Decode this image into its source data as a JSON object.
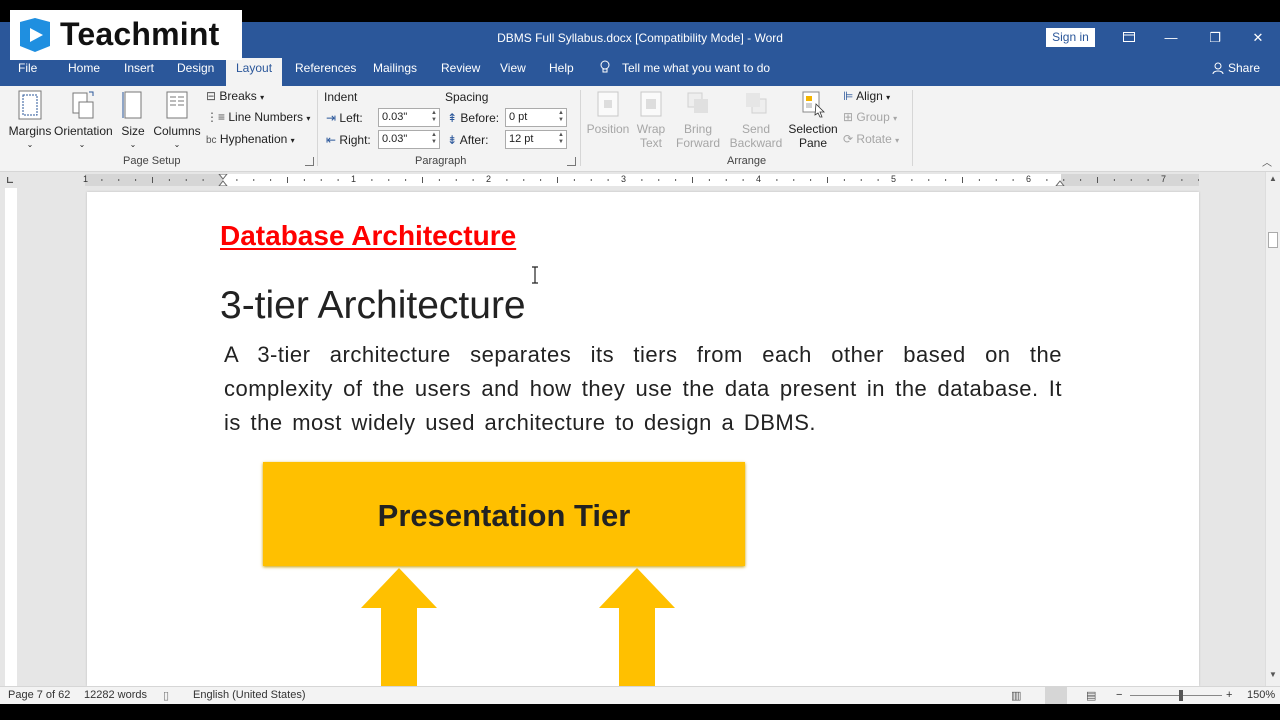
{
  "logo": {
    "text": "Teachmint"
  },
  "window": {
    "title": "DBMS Full Syllabus.docx [Compatibility Mode]  -  Word",
    "sign_in": "Sign in",
    "minimize": "—",
    "restore": "❐",
    "close": "✕"
  },
  "menu": {
    "tabs": [
      "File",
      "Home",
      "Insert",
      "Design",
      "Layout",
      "References",
      "Mailings",
      "Review",
      "View",
      "Help"
    ],
    "active": "Layout",
    "tell_me": "Tell me what you want to do",
    "share": "Share"
  },
  "ribbon": {
    "page_setup": {
      "margins": "Margins",
      "orientation": "Orientation",
      "size": "Size",
      "columns": "Columns",
      "breaks": "Breaks",
      "line_numbers": "Line Numbers",
      "hyphenation": "Hyphenation",
      "group_label": "Page Setup"
    },
    "paragraph": {
      "indent_label": "Indent",
      "spacing_label": "Spacing",
      "left_label": "Left:",
      "left_value": "0.03\"",
      "right_label": "Right:",
      "right_value": "0.03\"",
      "before_label": "Before:",
      "before_value": "0 pt",
      "after_label": "After:",
      "after_value": "12 pt",
      "group_label": "Paragraph"
    },
    "arrange": {
      "position": "Position",
      "wrap_text_1": "Wrap",
      "wrap_text_2": "Text",
      "bring_forward_1": "Bring",
      "bring_forward_2": "Forward",
      "send_backward_1": "Send",
      "send_backward_2": "Backward",
      "selection_pane_1": "Selection",
      "selection_pane_2": "Pane",
      "align": "Align",
      "group": "Group",
      "rotate": "Rotate",
      "group_label": "Arrange"
    }
  },
  "ruler": {
    "numbers": [
      "1",
      "1",
      "2",
      "3",
      "4",
      "5",
      "6",
      "7"
    ]
  },
  "document": {
    "heading": "Database Architecture",
    "subheading": "3-tier Architecture",
    "paragraph": "A 3-tier architecture separates its tiers from each other based on the complexity of the users and how they use the data present in the database. It is the most widely used architecture to design a DBMS.",
    "diagram_box": "Presentation Tier",
    "colors": {
      "heading": "#ff0000",
      "tier_box": "#ffc000",
      "arrow": "#ffc000"
    }
  },
  "status": {
    "page": "Page 7 of 62",
    "words": "12282 words",
    "language": "English (United States)",
    "zoom": "150%"
  },
  "colors": {
    "title_bar": "#2b579a",
    "ribbon_bg": "#f3f3f3"
  }
}
